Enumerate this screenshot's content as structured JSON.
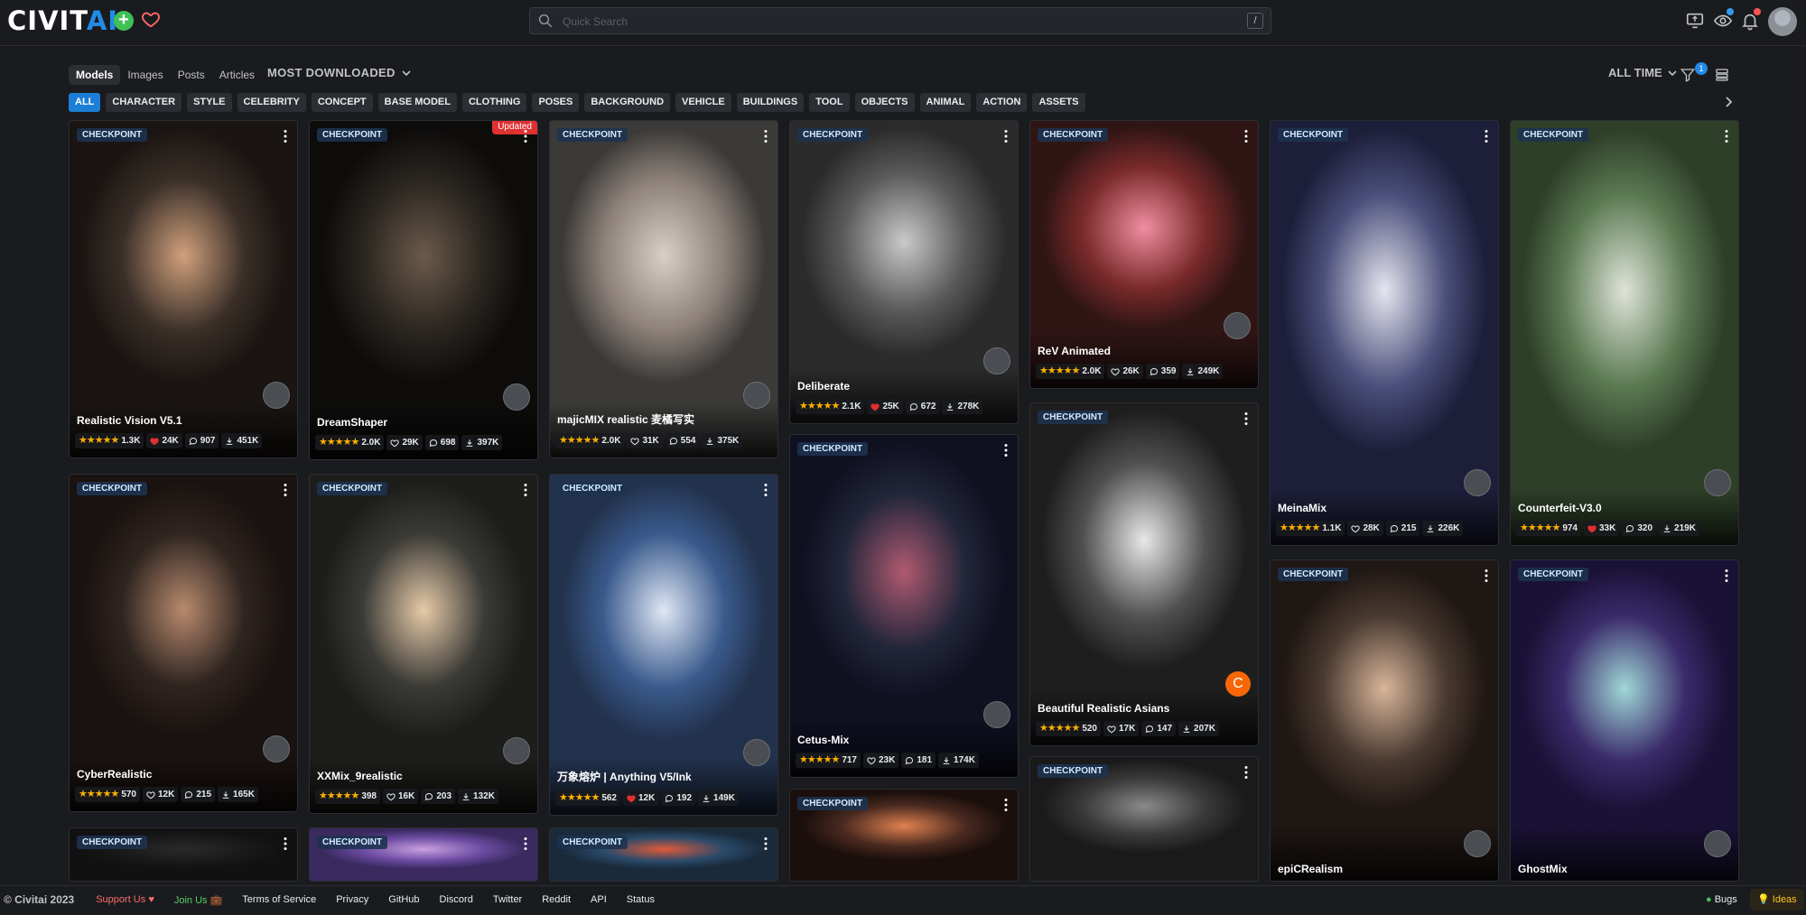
{
  "header": {
    "logo_prefix": "CIVIT",
    "logo_suffix": "AI",
    "search_placeholder": "Quick Search",
    "search_shortcut": "/",
    "filter_count": "1"
  },
  "toolbar": {
    "tabs": [
      {
        "label": "Models",
        "active": true
      },
      {
        "label": "Images",
        "active": false
      },
      {
        "label": "Posts",
        "active": false
      },
      {
        "label": "Articles",
        "active": false
      }
    ],
    "sort_label": "MOST DOWNLOADED",
    "period_label": "ALL TIME"
  },
  "categories": [
    "ALL",
    "CHARACTER",
    "STYLE",
    "CELEBRITY",
    "CONCEPT",
    "BASE MODEL",
    "CLOTHING",
    "POSES",
    "BACKGROUND",
    "VEHICLE",
    "BUILDINGS",
    "TOOL",
    "OBJECTS",
    "ANIMAL",
    "ACTION",
    "ASSETS"
  ],
  "cards": [
    {
      "badge": "CHECKPOINT",
      "name": "Realistic Vision V5.1",
      "rating": "1.3K",
      "likes": "24K",
      "comments": "907",
      "downloads": "451K",
      "liked": true
    },
    {
      "badge": "CHECKPOINT",
      "updated": "Updated",
      "name": "DreamShaper",
      "rating": "2.0K",
      "likes": "29K",
      "comments": "698",
      "downloads": "397K",
      "liked": false
    },
    {
      "badge": "CHECKPOINT",
      "name": "majicMIX realistic 麦橘写实",
      "rating": "2.0K",
      "likes": "31K",
      "comments": "554",
      "downloads": "375K",
      "liked": false
    },
    {
      "badge": "CHECKPOINT",
      "name": "Deliberate",
      "rating": "2.1K",
      "likes": "25K",
      "comments": "672",
      "downloads": "278K",
      "liked": true
    },
    {
      "badge": "CHECKPOINT",
      "name": "ReV Animated",
      "rating": "2.0K",
      "likes": "26K",
      "comments": "359",
      "downloads": "249K",
      "liked": false
    },
    {
      "badge": "CHECKPOINT",
      "name": "MeinaMix",
      "rating": "1.1K",
      "likes": "28K",
      "comments": "215",
      "downloads": "226K",
      "liked": false
    },
    {
      "badge": "CHECKPOINT",
      "name": "Counterfeit-V3.0",
      "rating": "974",
      "likes": "33K",
      "comments": "320",
      "downloads": "219K",
      "liked": true
    },
    {
      "badge": "CHECKPOINT",
      "name": "CyberRealistic",
      "rating": "570",
      "likes": "12K",
      "comments": "215",
      "downloads": "165K",
      "liked": false
    },
    {
      "badge": "CHECKPOINT",
      "name": "XXMix_9realistic",
      "rating": "398",
      "likes": "16K",
      "comments": "203",
      "downloads": "132K",
      "liked": false
    },
    {
      "badge": "CHECKPOINT",
      "name": "万象熔炉 | Anything V5/Ink",
      "rating": "562",
      "likes": "12K",
      "comments": "192",
      "downloads": "149K",
      "liked": true
    },
    {
      "badge": "CHECKPOINT",
      "name": "Cetus-Mix",
      "rating": "717",
      "likes": "23K",
      "comments": "181",
      "downloads": "174K",
      "liked": false
    },
    {
      "badge": "CHECKPOINT",
      "name": "Beautiful Realistic Asians",
      "rating": "520",
      "likes": "17K",
      "comments": "147",
      "downloads": "207K",
      "liked": false,
      "creator_initial": "C"
    },
    {
      "badge": "CHECKPOINT",
      "name": "epiCRealism"
    },
    {
      "badge": "CHECKPOINT",
      "name": "GhostMix"
    },
    {
      "badge": "CHECKPOINT"
    },
    {
      "badge": "CHECKPOINT"
    },
    {
      "badge": "CHECKPOINT"
    },
    {
      "badge": "CHECKPOINT"
    },
    {
      "badge": "CHECKPOINT"
    }
  ],
  "footer": {
    "copyright": "© Civitai 2023",
    "links": [
      "Support Us",
      "Join Us",
      "Terms of Service",
      "Privacy",
      "GitHub",
      "Discord",
      "Twitter",
      "Reddit",
      "API",
      "Status"
    ],
    "bugs": "Bugs",
    "ideas": "Ideas"
  },
  "colors": {
    "accent": "#1c7ed6",
    "star": "#fab005",
    "like": "#e03131",
    "background": "#1a1b1e"
  }
}
